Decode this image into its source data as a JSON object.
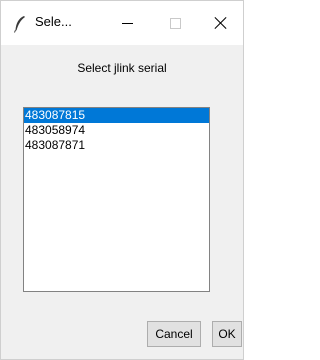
{
  "window": {
    "title": "Sele...",
    "accent_color": "#0078d7"
  },
  "dialog": {
    "prompt": "Select jlink serial",
    "serials": [
      {
        "label": "483087815",
        "selected": true
      },
      {
        "label": "483058974",
        "selected": false
      },
      {
        "label": "483087871",
        "selected": false
      }
    ],
    "cancel_label": "Cancel",
    "ok_label": "OK"
  },
  "icons": {
    "app": "feather-icon",
    "minimize": "minimize-icon",
    "maximize": "maximize-icon",
    "close": "close-icon"
  }
}
